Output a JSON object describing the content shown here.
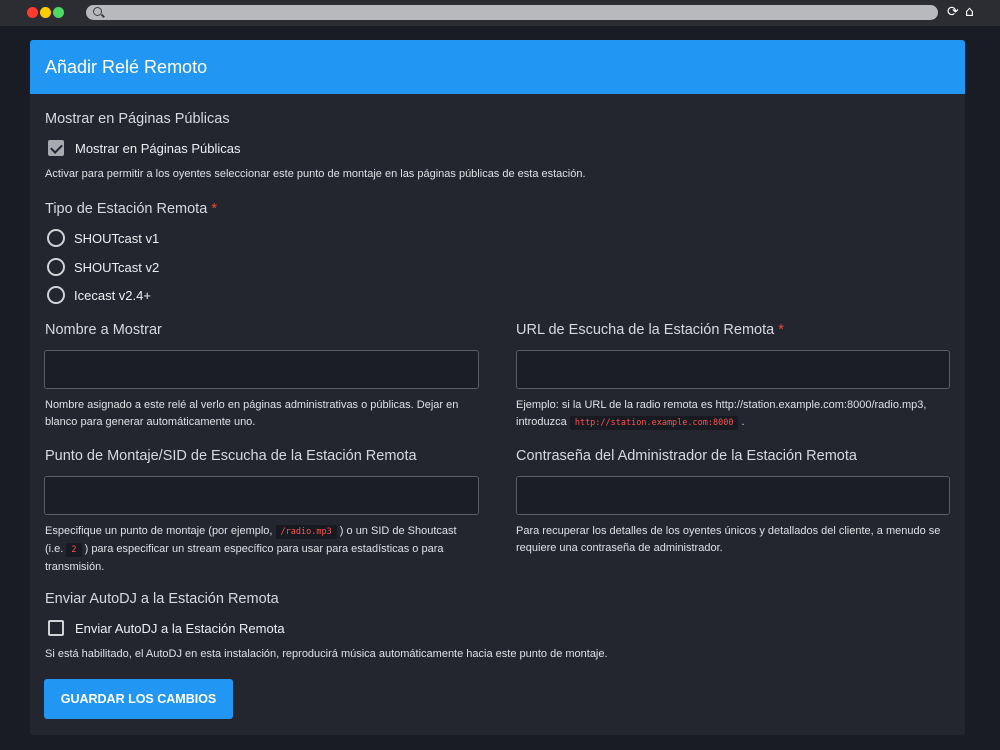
{
  "chrome": {
    "reload_icon": "⟳",
    "home_icon": "⌂"
  },
  "header": {
    "title": "Añadir Relé Remoto"
  },
  "public_pages": {
    "label": "Mostrar en Páginas Públicas",
    "checkbox_label": "Mostrar en Páginas Públicas",
    "checked": true,
    "help": "Activar para permitir a los oyentes seleccionar este punto de montaje en las páginas públicas de esta estación."
  },
  "station_type": {
    "label": "Tipo de Estación Remota",
    "required": "*",
    "options": [
      "SHOUTcast v1",
      "SHOUTcast v2",
      "Icecast v2.4+"
    ]
  },
  "display_name": {
    "label": "Nombre a Mostrar",
    "value": "",
    "help_line1": "Nombre asignado a este relé al verlo en páginas administrativas o públicas. Dejar en",
    "help_line2": "blanco para generar automáticamente uno."
  },
  "listen_url": {
    "label": "URL de Escucha de la Estación Remota",
    "required": "*",
    "value": "",
    "help_line1": "Ejemplo: si la URL de la radio remota es http://station.example.com:8000/radio.mp3,",
    "help_line2_prefix": "introduzca",
    "help_code": "http://station.example.com:8000",
    "help_line2_suffix": "."
  },
  "mount_point": {
    "label": "Punto de Montaje/SID de Escucha de la Estación Remota",
    "value": "",
    "help_prefix": "Especifique un punto de montaje (por ejemplo,",
    "help_code1": "/radio.mp3",
    "help_mid": ") o un SID de Shoutcast",
    "help_line2_prefix": "(i.e.",
    "help_code2": "2",
    "help_line2_suffix": ") para especificar un stream específico para usar para estadísticas o para",
    "help_line3": "transmisión."
  },
  "admin_password": {
    "label": "Contraseña del Administrador de la Estación Remota",
    "value": "",
    "help_line1": "Para recuperar los detalles de los oyentes únicos y detallados del cliente, a menudo se",
    "help_line2": "requiere una contraseña de administrador."
  },
  "autodj": {
    "label": "Enviar AutoDJ a la Estación Remota",
    "checkbox_label": "Enviar AutoDJ a la Estación Remota",
    "checked": false,
    "help": "Si está habilitado, el AutoDJ en esta instalación, reproducirá música automáticamente hacia este punto de montaje."
  },
  "actions": {
    "save_label": "GUARDAR LOS CAMBIOS"
  },
  "colors": {
    "accent": "#2196f3",
    "required": "#f44336",
    "background": "#191c24",
    "card": "#23262f"
  }
}
